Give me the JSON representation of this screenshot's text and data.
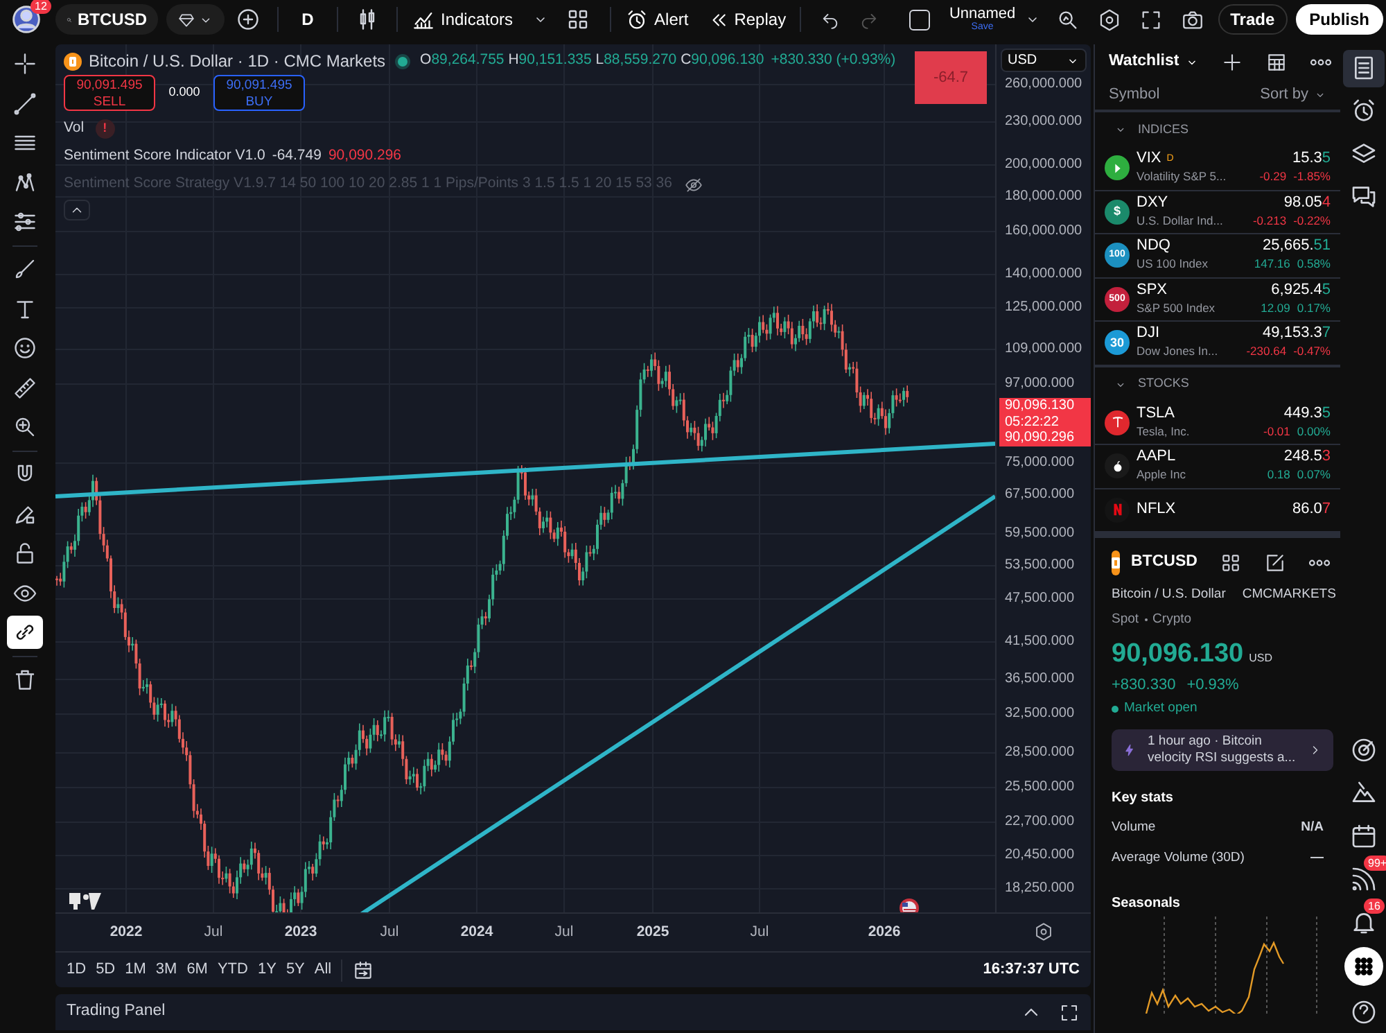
{
  "top_bar": {
    "notifications": "12",
    "symbol": "BTCUSD",
    "interval": "D",
    "indicators_label": "Indicators",
    "alert_label": "Alert",
    "replay_label": "Replay",
    "layout_checked": false,
    "layout_name": "Unnamed",
    "save_label": "Save",
    "trade_label": "Trade",
    "publish_label": "Publish"
  },
  "left_toolbar": [
    {
      "kind": "crosshair",
      "selected": false
    },
    {
      "kind": "line",
      "selected": false
    },
    {
      "kind": "lines",
      "selected": false
    },
    {
      "kind": "nodes",
      "selected": false
    },
    {
      "kind": "sliders",
      "selected": false
    },
    {
      "kind": "brush",
      "selected": false
    },
    {
      "kind": "text",
      "selected": false
    },
    {
      "kind": "smiley",
      "selected": false
    },
    {
      "kind": "ruler",
      "selected": false
    },
    {
      "kind": "zoom",
      "selected": false
    },
    {
      "kind": "magnet",
      "selected": false
    },
    {
      "kind": "pencil",
      "selected": false
    },
    {
      "kind": "lock",
      "selected": false
    },
    {
      "kind": "eye",
      "selected": false
    },
    {
      "kind": "link",
      "selected": true
    },
    {
      "kind": "trash",
      "selected": false
    }
  ],
  "chart": {
    "title": "Bitcoin / U.S. Dollar · 1D · CMC Markets",
    "ohlc": [
      {
        "key": "O",
        "value": "89,264.755"
      },
      {
        "key": "H",
        "value": "90,151.335"
      },
      {
        "key": "L",
        "value": "88,559.270"
      },
      {
        "key": "C",
        "value": "90,096.130"
      }
    ],
    "change": "+830.330 (+0.93%)",
    "sell": {
      "price": "90,091.495",
      "label": "SELL"
    },
    "spread": "0.000",
    "buy": {
      "price": "90,091.495",
      "label": "BUY"
    },
    "vol_label": "Vol",
    "vol_alert": "!",
    "indicators": [
      {
        "name": "Sentiment Score Indicator V1.0",
        "value": "-64.749",
        "value_2": "90,090.296",
        "hidden": false
      },
      {
        "name": "Sentiment Score Strategy V1.9.7 14 50 100 10 20 2.85 1 1 Pips/Points 3 1.5 1.5 1 20 15 53 36",
        "hidden": true
      }
    ],
    "score_box": "-64.7",
    "currency": "USD",
    "price_labels": [
      "260,000.000",
      "230,000.000",
      "200,000.000",
      "180,000.000",
      "160,000.000",
      "140,000.000",
      "125,000.000",
      "109,000.000",
      "97,000.000",
      "75,000.000",
      "67,500.000",
      "59,500.000",
      "53,500.000",
      "47,500.000",
      "41,500.000",
      "36,500.000",
      "32,500.000",
      "28,500.000",
      "25,500.000",
      "22,700.000",
      "20,450.000",
      "18,250.000"
    ],
    "last_price": {
      "price": "90,096.130",
      "countdown": "05:22:22",
      "indicator": "90,090.296"
    },
    "time_labels": [
      {
        "label": "2022",
        "major": true
      },
      {
        "label": "Jul",
        "major": false
      },
      {
        "label": "2023",
        "major": true
      },
      {
        "label": "Jul",
        "major": false
      },
      {
        "label": "2024",
        "major": true
      },
      {
        "label": "Jul",
        "major": false
      },
      {
        "label": "2025",
        "major": true
      },
      {
        "label": "Jul",
        "major": false
      },
      {
        "label": "2026",
        "major": true
      }
    ],
    "ranges": [
      "1D",
      "5D",
      "1M",
      "3M",
      "6M",
      "YTD",
      "1Y",
      "5Y",
      "All"
    ],
    "clock": "16:37:37 UTC"
  },
  "trading_panel": {
    "title": "Trading Panel"
  },
  "watchlist": {
    "title": "Watchlist",
    "symbol_header": "Symbol",
    "sort_label": "Sort by",
    "sections": [
      {
        "title": "INDICES",
        "items": [
          {
            "symbol": "VIX",
            "flag": "D",
            "name": "Volatility S&P 5...",
            "price": "15.3",
            "price_tick": "5",
            "tick_up": true,
            "change": "-0.29",
            "change_up": false,
            "change_pct": "-1.85%",
            "pct_up": false,
            "logo": {
              "kind": "arrow",
              "color": "#2eae3f"
            }
          },
          {
            "symbol": "DXY",
            "name": "U.S. Dollar Ind...",
            "price": "98.05",
            "price_tick": "4",
            "tick_up": false,
            "change": "-0.213",
            "change_up": false,
            "change_pct": "-0.22%",
            "pct_up": false,
            "logo": {
              "kind": "text",
              "text": "$",
              "color": "#1b8a6b"
            }
          },
          {
            "symbol": "NDQ",
            "name": "US 100 Index",
            "price": "25,665.",
            "price_tick": "51",
            "tick_up": true,
            "change": "147.16",
            "change_up": true,
            "change_pct": "0.58%",
            "pct_up": true,
            "logo": {
              "kind": "text",
              "text": "100",
              "color": "#1c90c0"
            }
          },
          {
            "symbol": "SPX",
            "name": "S&P 500 Index",
            "price": "6,925.4",
            "price_tick": "5",
            "tick_up": true,
            "change": "12.09",
            "change_up": true,
            "change_pct": "0.17%",
            "pct_up": true,
            "logo": {
              "kind": "text",
              "text": "500",
              "color": "#c3203c"
            }
          },
          {
            "symbol": "DJI",
            "name": "Dow Jones In...",
            "price": "49,153.3",
            "price_tick": "7",
            "tick_up": true,
            "change": "-230.64",
            "change_up": false,
            "change_pct": "-0.47%",
            "pct_up": false,
            "logo": {
              "kind": "text",
              "text": "30",
              "color": "#1c9ad6"
            }
          }
        ]
      },
      {
        "title": "STOCKS",
        "items": [
          {
            "symbol": "TSLA",
            "name": "Tesla, Inc.",
            "price": "449.3",
            "price_tick": "5",
            "tick_up": true,
            "change": "-0.01",
            "change_up": false,
            "change_pct": "0.00%",
            "pct_up": true,
            "logo": {
              "kind": "tesla",
              "color": "#e0282e"
            }
          },
          {
            "symbol": "AAPL",
            "name": "Apple Inc",
            "price": "248.5",
            "price_tick": "3",
            "tick_up": false,
            "change": "0.18",
            "change_up": true,
            "change_pct": "0.07%",
            "pct_up": true,
            "logo": {
              "kind": "apple",
              "color": "#1a1a1a"
            }
          },
          {
            "symbol": "NFLX",
            "price": "86.0",
            "price_tick": "7",
            "tick_up": false,
            "logo": {
              "kind": "netflix",
              "color": "#141414"
            }
          }
        ]
      }
    ]
  },
  "symbol_panel": {
    "symbol": "BTCUSD",
    "full_name": "Bitcoin / U.S. Dollar",
    "exchange": "CMCMARKETS",
    "type": "Spot",
    "category": "Crypto",
    "price": "90,096.130",
    "currency": "USD",
    "change": "+830.330",
    "change_pct": "+0.93%",
    "market_status": "Market open",
    "news": "1 hour ago · Bitcoin velocity RSI suggests a...",
    "key_stats_title": "Key stats",
    "stats": [
      {
        "label": "Volume",
        "value": "N/A"
      },
      {
        "label": "Average Volume (30D)",
        "value": "—"
      }
    ],
    "seasonals_title": "Seasonals"
  },
  "side_icons": [
    {
      "kind": "watchlist",
      "selected": true
    },
    {
      "kind": "alarm",
      "selected": false
    },
    {
      "kind": "layers",
      "selected": false
    },
    {
      "kind": "chat",
      "selected": false
    },
    {
      "kind": "target",
      "selected": false
    },
    {
      "kind": "mountain",
      "selected": false
    },
    {
      "kind": "calendar",
      "selected": false
    },
    {
      "kind": "feed",
      "selected": false,
      "badge": "99+"
    },
    {
      "kind": "bell",
      "selected": false,
      "badge": "16"
    },
    {
      "kind": "dots",
      "selected": true
    },
    {
      "kind": "help",
      "selected": false
    }
  ]
}
